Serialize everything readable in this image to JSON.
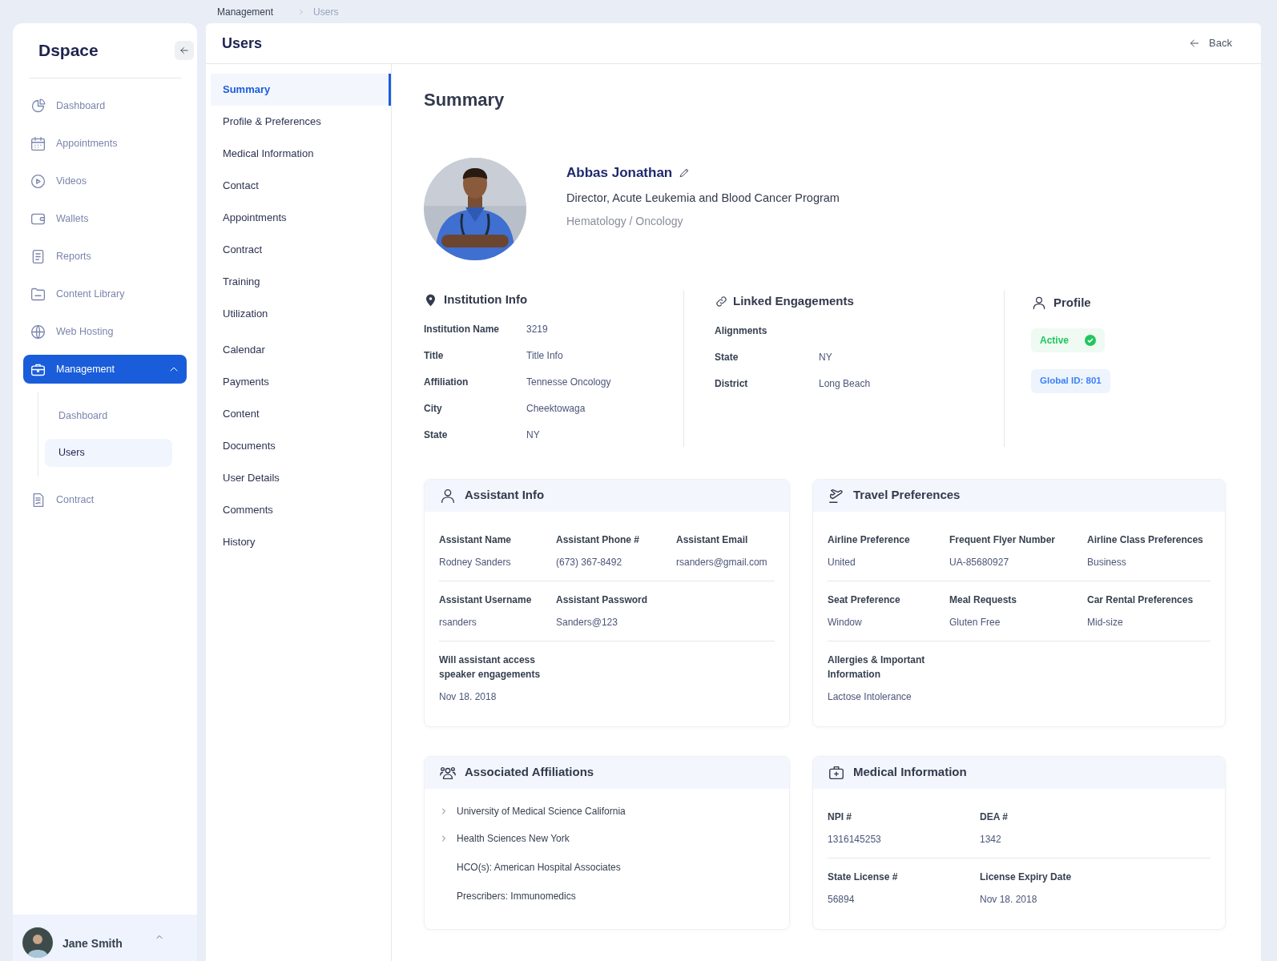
{
  "sidebar": {
    "logo": "Dspace",
    "items": [
      {
        "label": "Dashboard",
        "selected": false
      },
      {
        "label": "Appointments",
        "selected": false
      },
      {
        "label": "Videos",
        "selected": false
      },
      {
        "label": "Wallets",
        "selected": false
      },
      {
        "label": "Reports",
        "selected": false
      },
      {
        "label": "Content Library",
        "selected": false
      },
      {
        "label": "Web Hosting",
        "selected": false
      },
      {
        "label": "Management",
        "selected": true,
        "expanded": true,
        "children": [
          {
            "label": "Dashboard",
            "selected": false
          },
          {
            "label": "Users",
            "selected": true
          }
        ]
      },
      {
        "label": "Contract",
        "selected": false
      }
    ],
    "user": {
      "name": "Jane Smith"
    }
  },
  "breadcrumb": [
    "Management",
    "Users"
  ],
  "page": {
    "title": "Users",
    "back": "Back"
  },
  "subnav": [
    {
      "label": "Summary",
      "selected": true
    },
    {
      "label": "Profile & Preferences",
      "selected": false
    },
    {
      "label": "Medical Information",
      "selected": false
    },
    {
      "label": "Contact",
      "selected": false
    },
    {
      "label": "Appointments",
      "selected": false
    },
    {
      "label": "Contract",
      "selected": false
    },
    {
      "label": "Training",
      "selected": false
    },
    {
      "label": "Utilization",
      "selected": false
    },
    {
      "label": "Calendar",
      "selected": false
    },
    {
      "label": "Payments",
      "selected": false
    },
    {
      "label": "Content",
      "selected": false
    },
    {
      "label": "Documents",
      "selected": false
    },
    {
      "label": "User Details",
      "selected": false
    },
    {
      "label": "Comments",
      "selected": false
    },
    {
      "label": "History",
      "selected": false
    }
  ],
  "summary": {
    "heading": "Summary",
    "person": {
      "name": "Abbas Jonathan",
      "title": "Director, Acute Leukemia and Blood Cancer Program",
      "department": "Hematology / Oncology"
    },
    "institution": {
      "title": "Institution Info",
      "rows": [
        [
          "Institution Name",
          "3219"
        ],
        [
          "Title",
          "Title Info"
        ],
        [
          "Affiliation",
          "Tennesse Oncology"
        ],
        [
          "City",
          "Cheektowaga"
        ],
        [
          "State",
          "NY"
        ]
      ]
    },
    "linked": {
      "title": "Linked Engagements",
      "rows": [
        [
          "Alignments",
          ""
        ],
        [
          "State",
          "NY"
        ],
        [
          "District",
          "Long Beach"
        ]
      ]
    },
    "profile": {
      "title": "Profile",
      "status": "Active",
      "active": true,
      "global_id": "Global ID: 801"
    }
  },
  "assistant": {
    "title": "Assistant Info",
    "sections": [
      [
        [
          "Assistant Name",
          "Rodney Sanders"
        ],
        [
          "Assistant Phone #",
          "(673) 367-8492"
        ],
        [
          "Assistant Email",
          "rsanders@gmail.com"
        ]
      ],
      [
        [
          "Assistant Username",
          "rsanders"
        ],
        [
          "Assistant Password",
          "Sanders@123"
        ]
      ],
      [
        [
          "Will assistant access speaker engagements",
          "Nov 18. 2018"
        ]
      ]
    ]
  },
  "travel": {
    "title": "Travel Preferences",
    "sections": [
      [
        [
          "Airline Preference",
          "United"
        ],
        [
          "Frequent Flyer Number",
          "UA-85680927"
        ],
        [
          "Airline Class Preferences",
          "Business"
        ]
      ],
      [
        [
          "Seat Preference",
          "Window"
        ],
        [
          "Meal Requests",
          "Gluten Free"
        ],
        [
          "Car Rental Preferences",
          "Mid-size"
        ]
      ],
      [
        [
          "Allergies & Important Information",
          "Lactose Intolerance"
        ]
      ]
    ]
  },
  "affiliations": {
    "title": "Associated Affiliations",
    "items": [
      {
        "kind": "expandable",
        "label": "University of Medical Science California"
      },
      {
        "kind": "expandable",
        "label": "Health Sciences New York"
      },
      {
        "kind": "plain",
        "label": "HCO(s): American Hospital Associates"
      },
      {
        "kind": "plain",
        "label": "Prescribers: Immunomedics"
      }
    ]
  },
  "medical": {
    "title": "Medical Information",
    "sections": [
      [
        [
          "NPI #",
          "1316145253"
        ],
        [
          "DEA #",
          "1342"
        ]
      ],
      [
        [
          "State License #",
          "56894"
        ],
        [
          "License Expiry Date",
          "Nov 18. 2018"
        ]
      ]
    ]
  }
}
